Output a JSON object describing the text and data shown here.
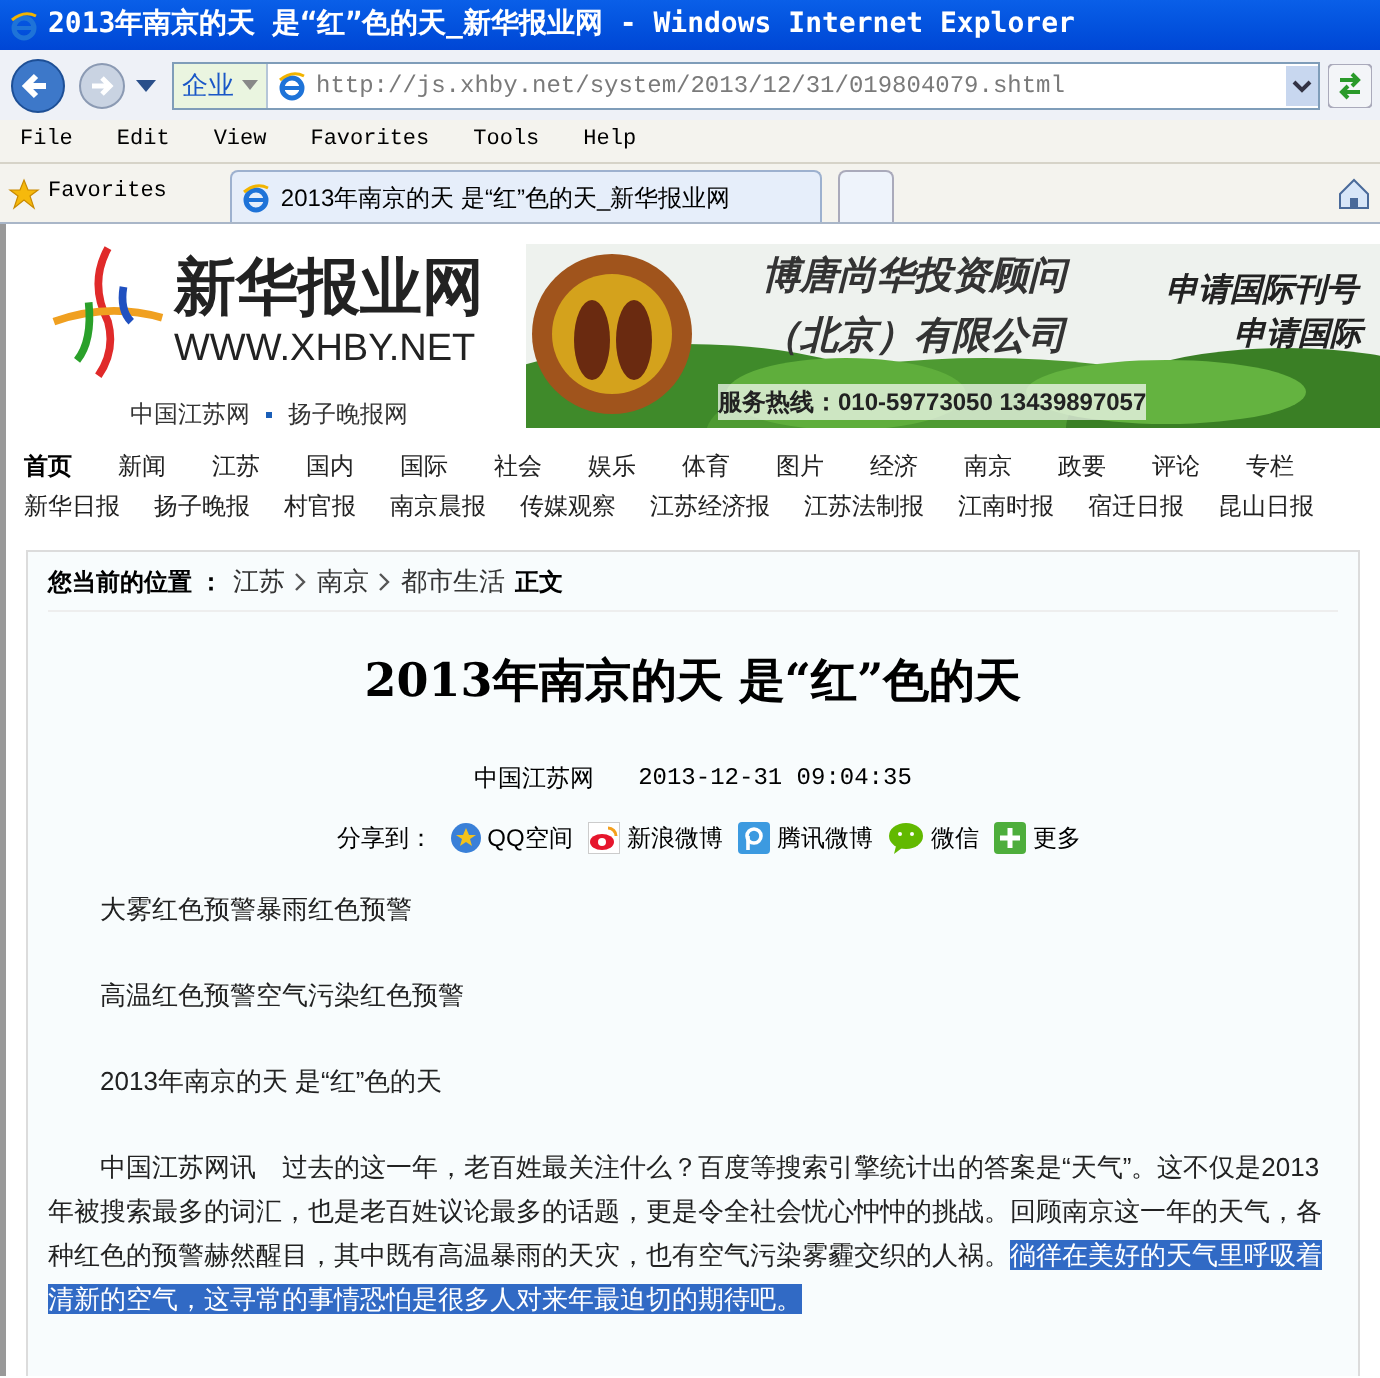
{
  "window": {
    "title": "2013年南京的天 是“红”色的天_新华报业网 - Windows Internet Explorer"
  },
  "address_bar": {
    "zone": "企业",
    "url": "http://js.xhby.net/system/2013/12/31/019804079.shtml"
  },
  "menu": [
    "File",
    "Edit",
    "View",
    "Favorites",
    "Tools",
    "Help"
  ],
  "favorites_bar": {
    "label": "Favorites",
    "tabs": [
      {
        "label": "2013年南京的天 是“红”色的天_新华报业网",
        "selected": true
      }
    ]
  },
  "site": {
    "logo_name": "新华报业网",
    "logo_url": "WWW.XHBY.NET",
    "sublinks": [
      "中国江苏网",
      "扬子晚报网"
    ]
  },
  "ad_banner": {
    "kind": "picture",
    "texts": [
      "博唐尚华投资顾问",
      "（北京）有限公司",
      "服务热线：010-59773050 13439897057",
      "申请国际刊号",
      "申请国际"
    ]
  },
  "nav": [
    {
      "label": "首页",
      "selected": true
    },
    {
      "label": "新闻",
      "selected": false
    },
    {
      "label": "江苏",
      "selected": false
    },
    {
      "label": "国内",
      "selected": false
    },
    {
      "label": "国际",
      "selected": false
    },
    {
      "label": "社会",
      "selected": false
    },
    {
      "label": "娱乐",
      "selected": false
    },
    {
      "label": "体育",
      "selected": false
    },
    {
      "label": "图片",
      "selected": false
    },
    {
      "label": "经济",
      "selected": false
    },
    {
      "label": "南京",
      "selected": false
    },
    {
      "label": "政要",
      "selected": false
    },
    {
      "label": "评论",
      "selected": false
    },
    {
      "label": "专栏",
      "selected": false
    }
  ],
  "papers": [
    "新华日报",
    "扬子晚报",
    "村官报",
    "南京晨报",
    "传媒观察",
    "江苏经济报",
    "江苏法制报",
    "江南时报",
    "宿迁日报",
    "昆山日报"
  ],
  "breadcrumb": {
    "label": "您当前的位置 ：",
    "items": [
      "江苏",
      "南京",
      "都市生活"
    ],
    "current": "正文"
  },
  "article": {
    "title": "2013年南京的天 是“红”色的天",
    "source": "中国江苏网",
    "time": "2013-12-31 09:04:35",
    "share": {
      "label": "分享到：",
      "items": [
        {
          "kind": "qzone",
          "label": "QQ空间"
        },
        {
          "kind": "weibo",
          "label": "新浪微博"
        },
        {
          "kind": "tweibo",
          "label": "腾讯微博"
        },
        {
          "kind": "wechat",
          "label": "微信"
        },
        {
          "kind": "more",
          "label": "更多"
        }
      ]
    },
    "paragraphs": [
      {
        "text": "大雾红色预警暴雨红色预警"
      },
      {
        "text": "高温红色预警空气污染红色预警"
      },
      {
        "text": "2013年南京的天 是“红”色的天"
      },
      {
        "text": "中国江苏网讯　过去的这一年，老百姓最关注什么？百度等搜索引擎统计出的答案是“天气”。这不仅是2013年被搜索最多的词汇，也是老百姓议论最多的话题，更是令全社会忧心忡忡的挑战。回顾南京这一年的天气，各种红色的预警赫然醒目，其中既有高温暴雨的天灾，也有空气污染雾霾交织的人祸。",
        "selected_text": "徜徉在美好的天气里呼吸着清新的空气，这寻常的事情恐怕是很多人对来年最迫切的期待吧。"
      }
    ]
  }
}
